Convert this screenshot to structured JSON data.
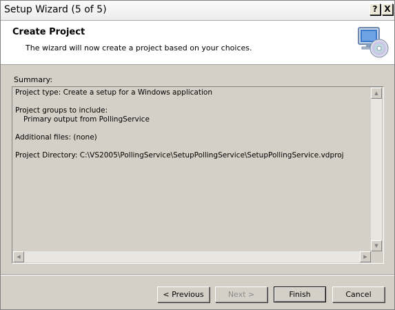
{
  "window": {
    "title": "Setup Wizard (5 of 5)",
    "help_label": "?",
    "close_label": "X"
  },
  "header": {
    "title": "Create Project",
    "subtitle": "The wizard will now create a project based on your choices.",
    "icon": "computer-cd-icon"
  },
  "summary": {
    "label": "Summary:",
    "project_type": "Project type: Create a setup for a Windows application",
    "groups_heading": "Project groups to include:",
    "groups_item": "Primary output from PollingService",
    "additional_files": "Additional files: (none)",
    "project_directory": "Project Directory: C:\\VS2005\\PollingService\\SetupPollingService\\SetupPollingService.vdproj"
  },
  "scrollbars": {
    "up_icon": "arrow-up-icon",
    "down_icon": "arrow-down-icon",
    "left_icon": "arrow-left-icon",
    "right_icon": "arrow-right-icon"
  },
  "buttons": {
    "previous": "< Previous",
    "next": "Next >",
    "finish": "Finish",
    "cancel": "Cancel"
  }
}
